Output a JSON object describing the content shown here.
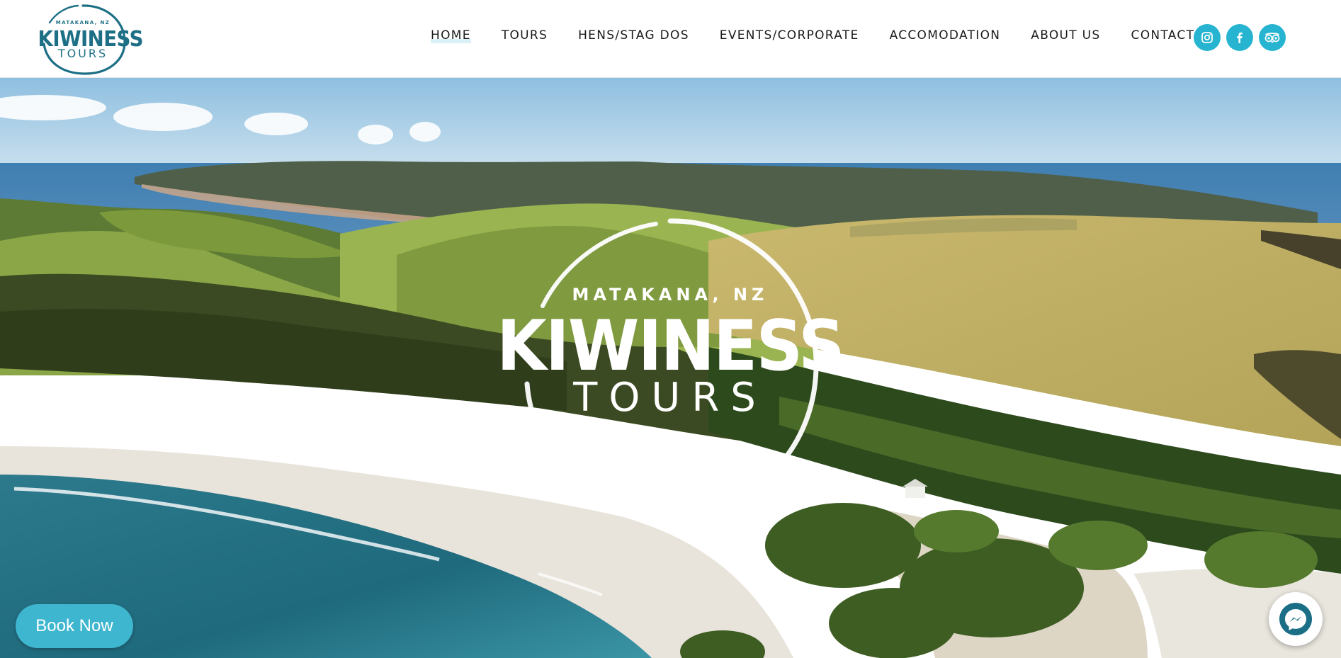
{
  "brand": {
    "logo_top": "MATAKANA, NZ",
    "logo_main": "KIWINESS",
    "logo_bottom": "TOURS",
    "primary_color": "#1d6f86",
    "accent_color": "#26b4d0"
  },
  "nav": {
    "items": [
      {
        "label": "HOME",
        "active": true
      },
      {
        "label": "TOURS",
        "active": false
      },
      {
        "label": "HENS/STAG DOS",
        "active": false
      },
      {
        "label": "EVENTS/CORPORATE",
        "active": false
      },
      {
        "label": "ACCOMODATION",
        "active": false
      },
      {
        "label": "ABOUT US",
        "active": false
      },
      {
        "label": "CONTACT",
        "active": false
      }
    ]
  },
  "socials": [
    {
      "icon": "instagram-icon"
    },
    {
      "icon": "facebook-icon"
    },
    {
      "icon": "tripadvisor-icon"
    }
  ],
  "hero": {
    "logo_top": "MATAKANA, NZ",
    "logo_main": "KIWINESS",
    "logo_bottom": "TOURS"
  },
  "book_button": {
    "label": "Book Now"
  },
  "chat": {
    "icon": "messenger-icon"
  }
}
